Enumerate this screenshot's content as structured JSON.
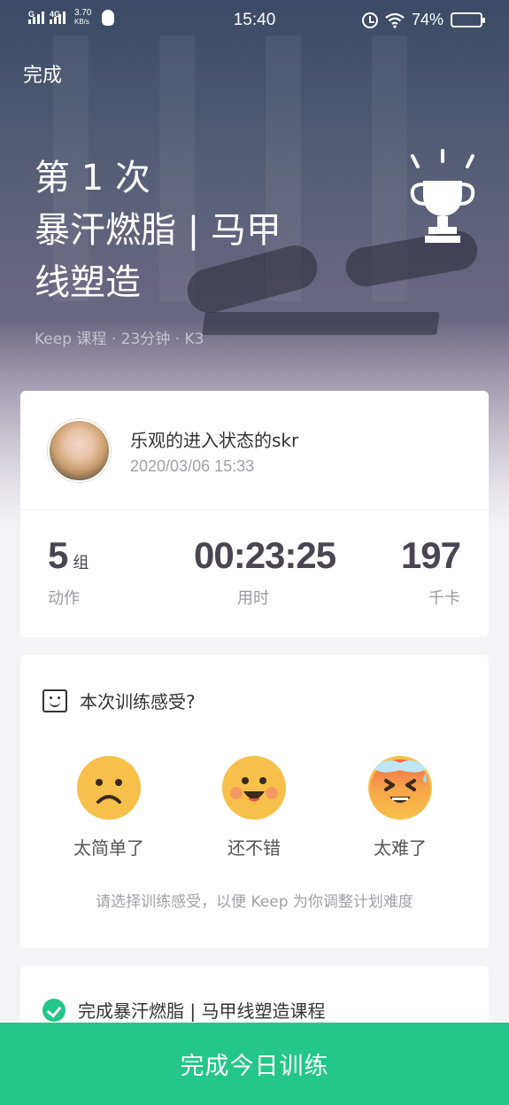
{
  "status_bar": {
    "signal1_label": "G",
    "signal2_label": "4G",
    "speed_value": "3.70",
    "speed_unit": "KB/s",
    "time": "15:40",
    "battery_percent": "74%",
    "battery_level": 0.74
  },
  "nav": {
    "done_label": "完成"
  },
  "hero": {
    "title_lines": [
      "第 1 次",
      "暴汗燃脂 | 马甲",
      "线塑造"
    ],
    "meta": "Keep 课程 · 23分钟 · K3"
  },
  "summary": {
    "user_name": "乐观的进入状态的skr",
    "datetime": "2020/03/06 15:33",
    "stats": [
      {
        "value": "5",
        "unit": "组",
        "label": "动作"
      },
      {
        "value": "00:23:25",
        "unit": "",
        "label": "用时"
      },
      {
        "value": "197",
        "unit": "",
        "label": "千卡"
      }
    ]
  },
  "feedback": {
    "title": "本次训练感受?",
    "options": [
      {
        "label": "太简单了",
        "icon": "sad-face-icon"
      },
      {
        "label": "还不错",
        "icon": "happy-face-icon"
      },
      {
        "label": "太难了",
        "icon": "exhausted-face-icon"
      }
    ],
    "hint": "请选择训练感受，以便 Keep 为你调整计划难度"
  },
  "tasks": [
    {
      "text": "完成暴汗燃脂 | 马甲线塑造课程",
      "done": true
    }
  ],
  "footer": {
    "button_label": "完成今日训练"
  },
  "colors": {
    "accent": "#24c789",
    "emoji": "#f7c04a"
  }
}
